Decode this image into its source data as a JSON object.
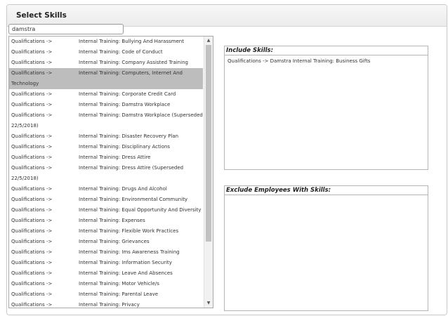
{
  "panel": {
    "title": "Select Skills"
  },
  "search": {
    "value": "damstra",
    "placeholder": ""
  },
  "skills_list": {
    "items": [
      {
        "category": "Qualifications ->",
        "name": "Internal Training: Bullying And Harassment"
      },
      {
        "category": "Qualifications ->",
        "name": "Internal Training: Code of Conduct"
      },
      {
        "category": "Qualifications ->",
        "name": "Internal Training: Company Assisted Training"
      },
      {
        "category": "Qualifications -> Technology",
        "name": "Internal Training: Computers, Internet And"
      },
      {
        "category": "Qualifications ->",
        "name": "Internal Training: Corporate Credit Card"
      },
      {
        "category": "Qualifications ->",
        "name": "Internal Training: Damstra Workplace"
      },
      {
        "category": "Qualifications -> 22/5/2018)",
        "name": "Internal Training: Damstra Workplace (Superseded"
      },
      {
        "category": "Qualifications ->",
        "name": "Internal Training: Disaster Recovery Plan"
      },
      {
        "category": "Qualifications ->",
        "name": "Internal Training: Disciplinary Actions"
      },
      {
        "category": "Qualifications ->",
        "name": "Internal Training: Dress Attire"
      },
      {
        "category": "Qualifications -> 22/5/2018)",
        "name": "Internal Training: Dress Attire (Superseded"
      },
      {
        "category": "Qualifications ->",
        "name": "Internal Training: Drugs And Alcohol"
      },
      {
        "category": "Qualifications ->",
        "name": "Internal Training: Environmental Community"
      },
      {
        "category": "Qualifications ->",
        "name": "Internal Training: Equal Opportunity And Diversity"
      },
      {
        "category": "Qualifications ->",
        "name": "Internal Training: Expenses"
      },
      {
        "category": "Qualifications ->",
        "name": "Internal Training: Flexible Work Practices"
      },
      {
        "category": "Qualifications ->",
        "name": "Internal Training: Grievances"
      },
      {
        "category": "Qualifications ->",
        "name": "Internal Training: Ims Awareness Training"
      },
      {
        "category": "Qualifications ->",
        "name": "Internal Training: Information Security"
      },
      {
        "category": "Qualifications ->",
        "name": "Internal Training: Leave And Absences"
      },
      {
        "category": "Qualifications ->",
        "name": "Internal Training: Motor Vehicle/s"
      },
      {
        "category": "Qualifications ->",
        "name": "Internal Training: Parental Leave"
      },
      {
        "category": "Qualifications ->",
        "name": "Internal Training: Privacy"
      }
    ],
    "selected_index": 3,
    "scroll_up_icon": "triangle-up",
    "scroll_down_icon": "triangle-down"
  },
  "include_box": {
    "title": "Include Skills:",
    "items": [
      "Qualifications -> Damstra Internal Training: Business Gifts"
    ]
  },
  "exclude_box": {
    "title": "Exclude Employees With Skills:",
    "items": []
  }
}
